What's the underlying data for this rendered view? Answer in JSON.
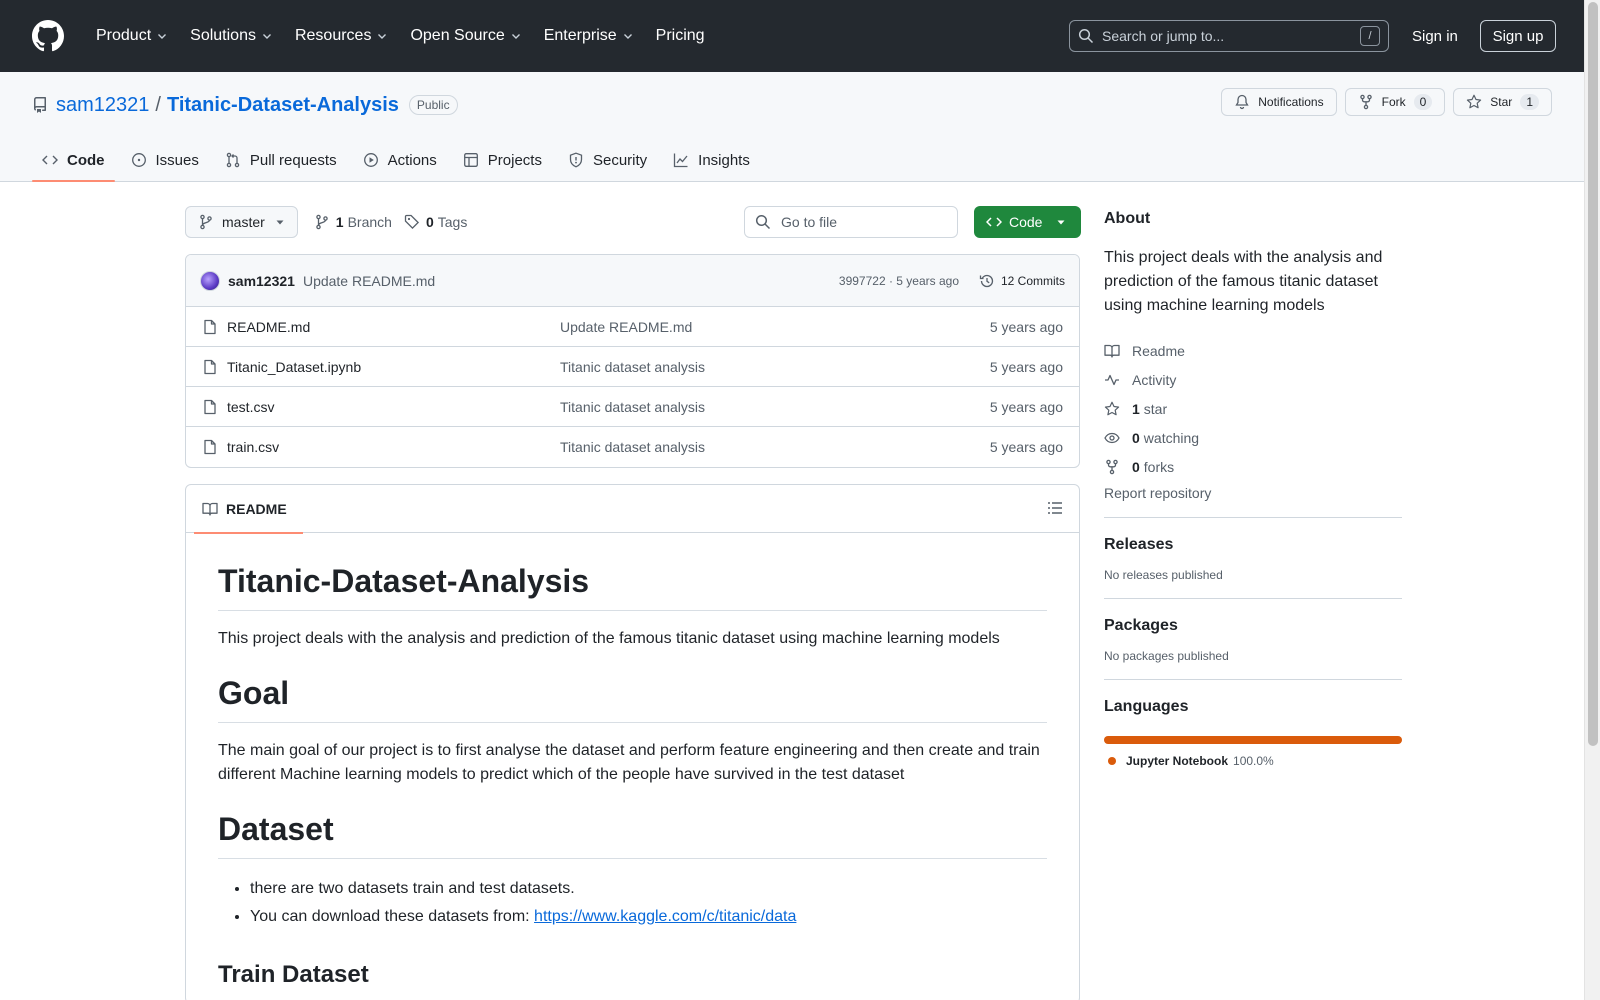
{
  "header": {
    "nav": [
      "Product",
      "Solutions",
      "Resources",
      "Open Source",
      "Enterprise",
      "Pricing"
    ],
    "search_placeholder": "Search or jump to...",
    "search_kbd": "/",
    "signin": "Sign in",
    "signup": "Sign up"
  },
  "repo": {
    "owner": "sam12321",
    "separator": "/",
    "name": "Titanic-Dataset-Analysis",
    "visibility": "Public",
    "actions": {
      "notifications": "Notifications",
      "fork": "Fork",
      "fork_count": "0",
      "star": "Star",
      "star_count": "1"
    },
    "tabs": [
      "Code",
      "Issues",
      "Pull requests",
      "Actions",
      "Projects",
      "Security",
      "Insights"
    ]
  },
  "toolbar": {
    "branch": "master",
    "branch_count": "1",
    "branch_label": "Branch",
    "tag_count": "0",
    "tag_label": "Tags",
    "goto_placeholder": "Go to file",
    "code_button": "Code"
  },
  "commit": {
    "author": "sam12321",
    "message": "Update README.md",
    "hash_time": "3997722 · 5 years ago",
    "commits": "12 Commits"
  },
  "files": [
    {
      "name": "README.md",
      "message": "Update README.md",
      "age": "5 years ago"
    },
    {
      "name": "Titanic_Dataset.ipynb",
      "message": "Titanic dataset analysis",
      "age": "5 years ago"
    },
    {
      "name": "test.csv",
      "message": "Titanic dataset analysis",
      "age": "5 years ago"
    },
    {
      "name": "train.csv",
      "message": "Titanic dataset analysis",
      "age": "5 years ago"
    }
  ],
  "readme": {
    "tab": "README",
    "title": "Titanic-Dataset-Analysis",
    "intro": "This project deals with the analysis and prediction of the famous titanic dataset using machine learning models",
    "goal_heading": "Goal",
    "goal_text": "The main goal of our project is to first analyse the dataset and perform feature engineering and then create and train different Machine learning models to predict which of the people have survived in the test dataset",
    "dataset_heading": "Dataset",
    "bullet1": "there are two datasets train and test datasets.",
    "bullet2_prefix": "You can download these datasets from: ",
    "bullet2_link": "https://www.kaggle.com/c/titanic/data",
    "train_heading": "Train Dataset"
  },
  "sidebar": {
    "about_heading": "About",
    "description": "This project deals with the analysis and prediction of the famous titanic dataset using machine learning models",
    "readme": "Readme",
    "activity": "Activity",
    "stars_count": "1",
    "stars_label": "star",
    "watching_count": "0",
    "watching_label": "watching",
    "forks_count": "0",
    "forks_label": "forks",
    "report": "Report repository",
    "releases_heading": "Releases",
    "releases_text": "No releases published",
    "packages_heading": "Packages",
    "packages_text": "No packages published",
    "languages_heading": "Languages",
    "language": "Jupyter Notebook",
    "language_pct": "100.0%",
    "language_color": "#DA5B0B"
  },
  "colors": {
    "header_bg": "#24292f",
    "link": "#0969da",
    "primary_button": "#1f883d",
    "active_tab_underline": "#fd8c73"
  }
}
